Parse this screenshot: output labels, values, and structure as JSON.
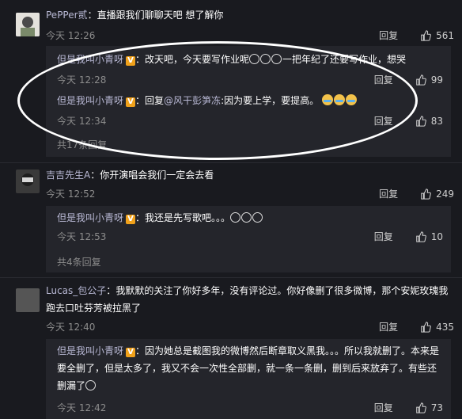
{
  "comments": [
    {
      "user": "PePPer贰",
      "colon": "：",
      "text": "直播跟我们聊聊天吧 想了解你",
      "time": "今天 12:26",
      "reply": "回复",
      "likes": "561"
    },
    {
      "user": "吉吉先生A",
      "colon": "：",
      "text": "你开演唱会我们一定会去看",
      "time": "今天 12:52",
      "reply": "回复",
      "likes": "249"
    },
    {
      "user": "Lucas_包公子",
      "colon": "：",
      "text": "我默默的关注了你好多年，没有评论过。你好像删了很多微博，那个安妮玫瑰我跑去口吐芬芳被拉黑了",
      "time": "今天 12:40",
      "reply": "回复",
      "likes": "435"
    }
  ],
  "subs": [
    {
      "user": "但是我叫小青呀",
      "colon": "：",
      "text": "改天吧，今天要写作业呢",
      "text2": "一把年纪了还要写作业，想哭",
      "time": "今天 12:28",
      "reply": "回复",
      "likes": "99"
    },
    {
      "user": "但是我叫小青呀",
      "colon": "：",
      "text": "回复",
      "mention": "@风干彭笋冻",
      "text2": ":因为要上学，要提高。",
      "time": "今天 12:34",
      "reply": "回复",
      "likes": "83"
    },
    {
      "user": "但是我叫小青呀",
      "colon": "：",
      "text": "我还是先写歌吧。。。",
      "time": "今天 12:53",
      "reply": "回复",
      "likes": "10"
    },
    {
      "user": "但是我叫小青呀",
      "colon": "：",
      "text": "因为她总是截图我的微博然后断章取义黑我。。。所以我就删了。本来是要全删了，但是太多了，我又不会一次性全部删，就一条一条删，删到后来放弃了。有些还删漏了",
      "time": "今天 12:42",
      "reply": "回复",
      "likes": "73"
    }
  ],
  "more": [
    "共17条回复",
    "共4条回复"
  ],
  "vbadge": "V"
}
